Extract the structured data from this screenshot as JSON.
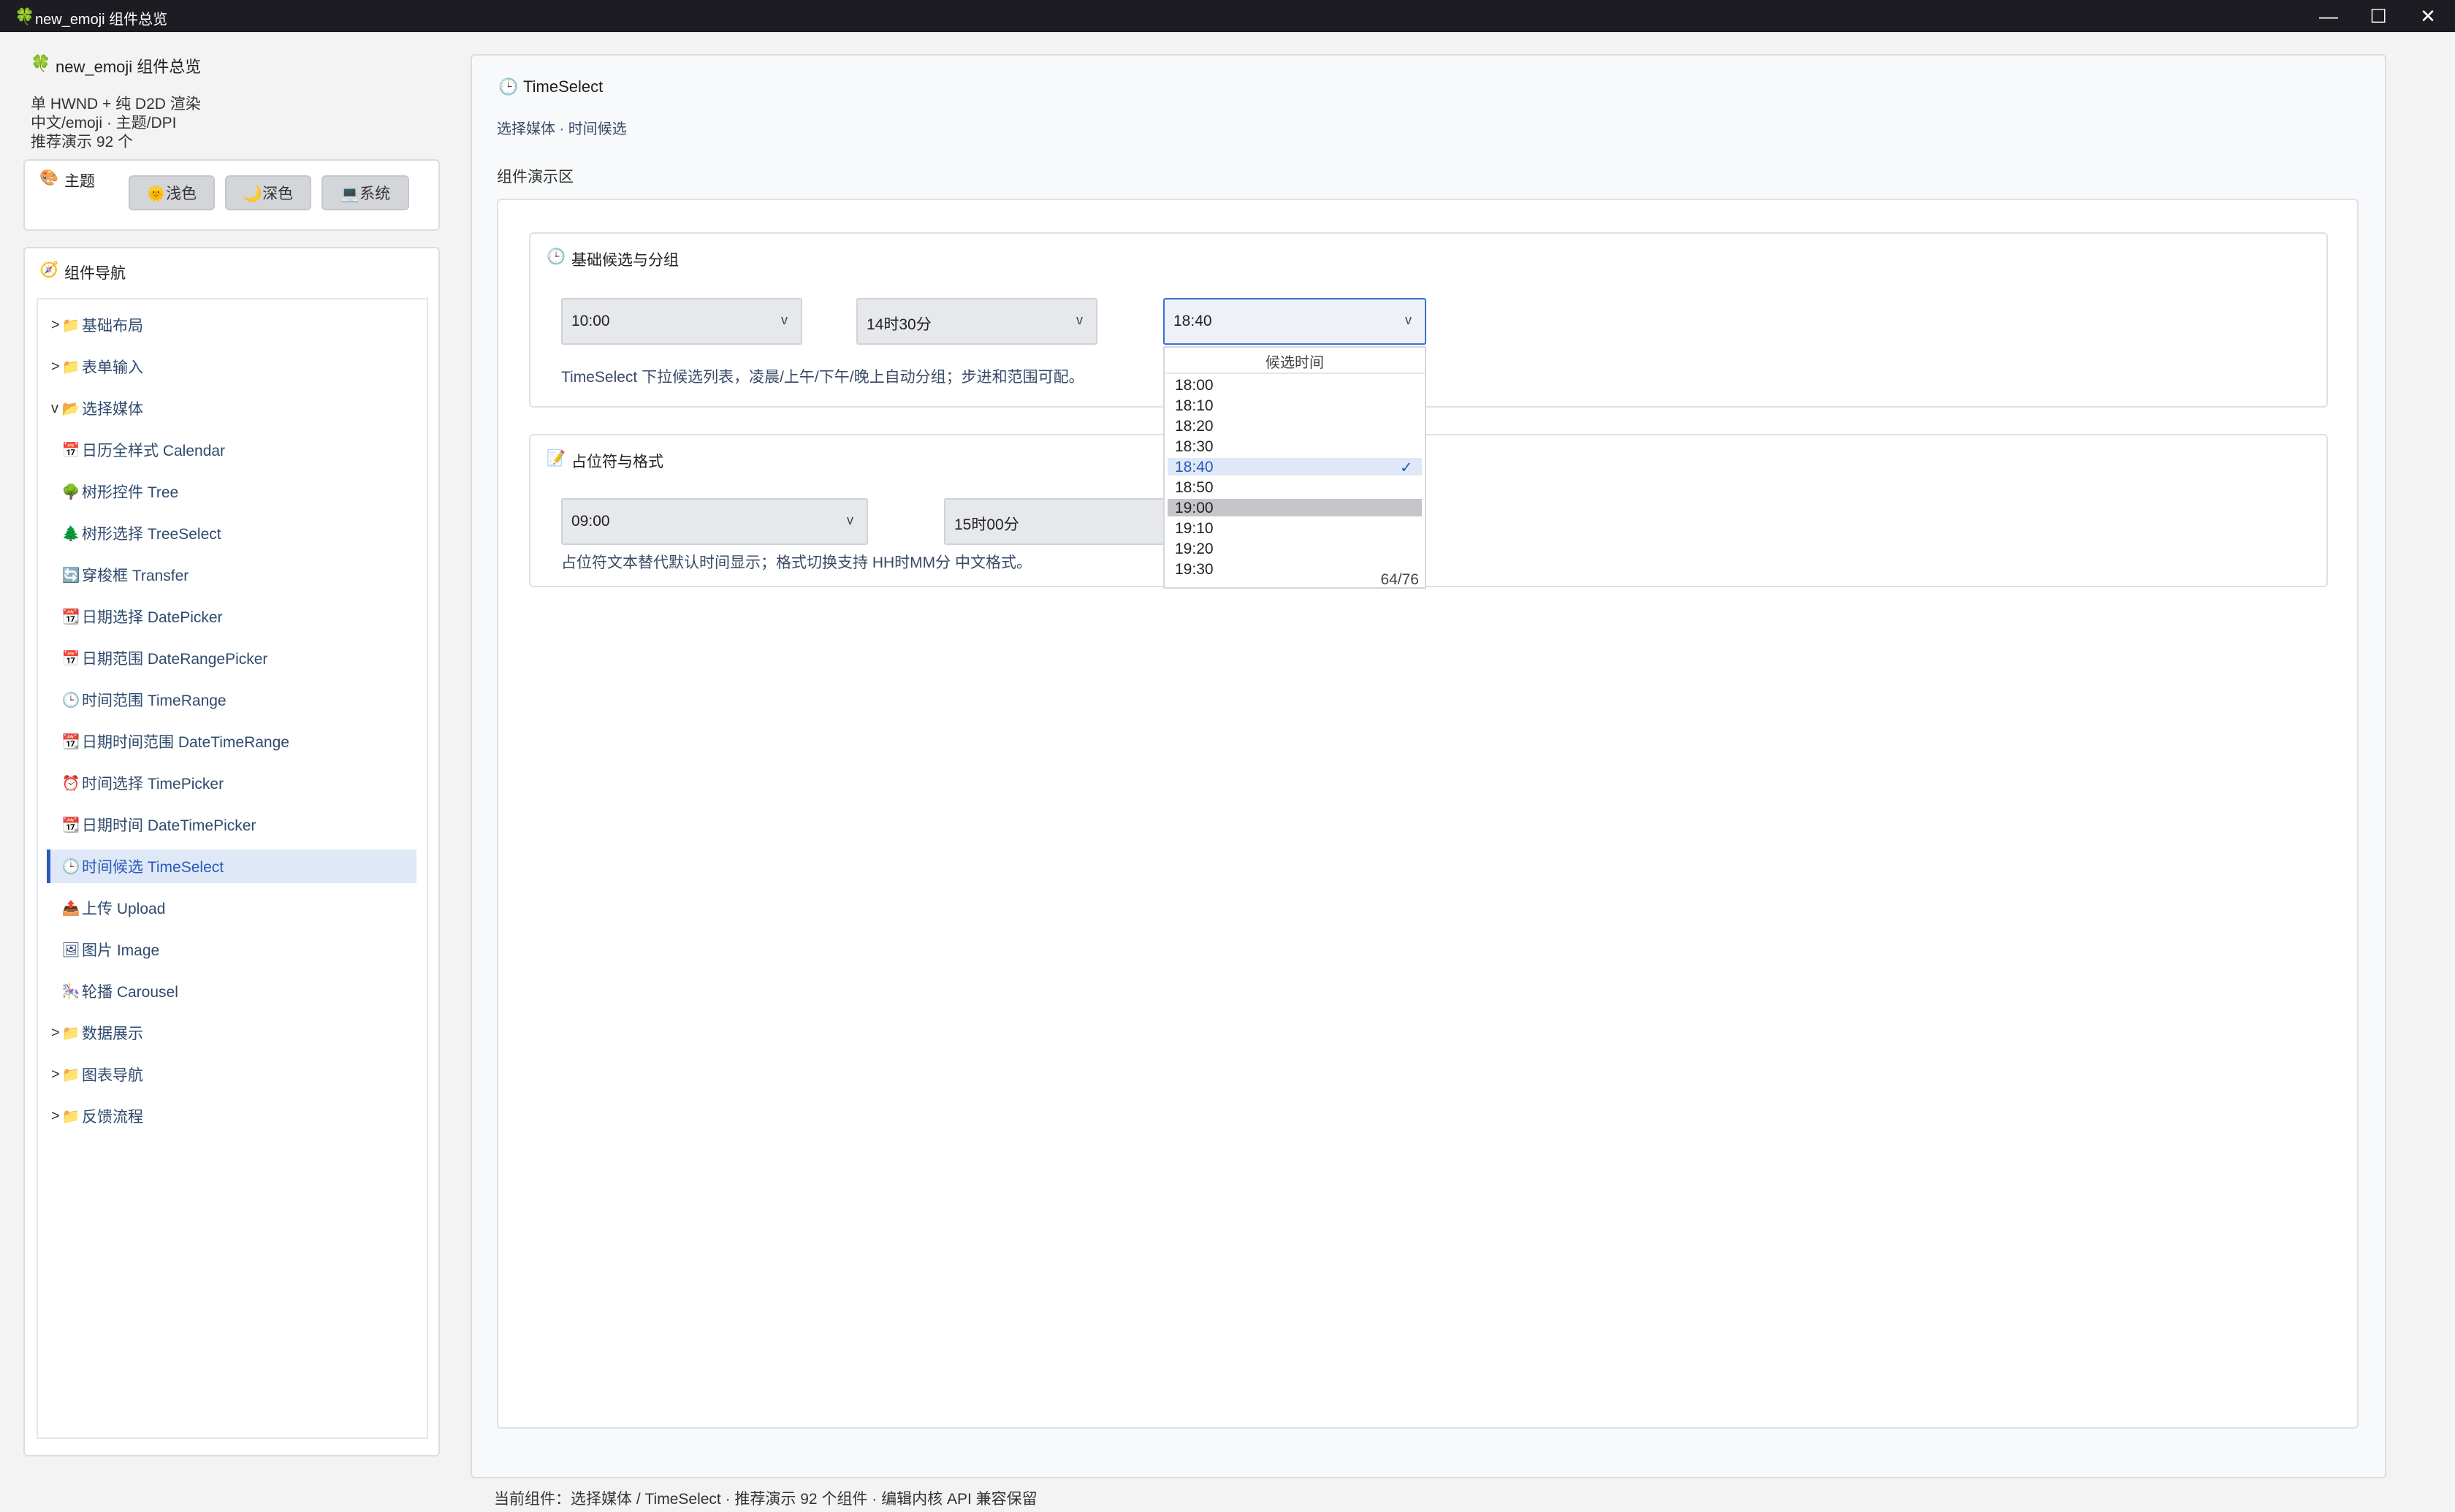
{
  "window": {
    "title": "new_emoji 组件总览",
    "minimize": "—",
    "maximize": "☐",
    "close": "✕"
  },
  "sidebar": {
    "app_title": "new_emoji 组件总览",
    "info_lines": [
      "单 HWND + 纯 D2D 渲染",
      "中文/emoji · 主题/DPI",
      "推荐演示 92 个"
    ],
    "theme": {
      "label": "主题",
      "buttons": [
        "🌞浅色",
        "🌙深色",
        "💻系统"
      ]
    },
    "nav": {
      "title": "组件导航",
      "items": [
        {
          "caret": ">",
          "icon": "📁",
          "label": "基础布局"
        },
        {
          "caret": ">",
          "icon": "📁",
          "label": "表单输入"
        },
        {
          "caret": "v",
          "icon": "📂",
          "label": "选择媒体"
        },
        {
          "icon": "📅",
          "label": "日历全样式 Calendar"
        },
        {
          "icon": "🌳",
          "label": "树形控件 Tree"
        },
        {
          "icon": "🌲",
          "label": "树形选择 TreeSelect"
        },
        {
          "icon": "🔄",
          "label": "穿梭框 Transfer"
        },
        {
          "icon": "📆",
          "label": "日期选择 DatePicker"
        },
        {
          "icon": "📅",
          "label": "日期范围 DateRangePicker"
        },
        {
          "icon": "🕒",
          "label": "时间范围 TimeRange"
        },
        {
          "icon": "📆",
          "label": "日期时间范围 DateTimeRange"
        },
        {
          "icon": "⏰",
          "label": "时间选择 TimePicker"
        },
        {
          "icon": "📆",
          "label": "日期时间 DateTimePicker"
        },
        {
          "icon": "🕒",
          "label": "时间候选 TimeSelect",
          "selected": true
        },
        {
          "icon": "📤",
          "label": "上传 Upload"
        },
        {
          "icon": "🖼",
          "label": "图片 Image"
        },
        {
          "icon": "🎠",
          "label": "轮播 Carousel"
        },
        {
          "caret": ">",
          "icon": "📁",
          "label": "数据展示"
        },
        {
          "caret": ">",
          "icon": "📁",
          "label": "图表导航"
        },
        {
          "caret": ">",
          "icon": "📁",
          "label": "反馈流程"
        }
      ]
    }
  },
  "main": {
    "title": "TimeSelect",
    "subtitle": "选择媒体 · 时间候选",
    "demo_area_label": "组件演示区",
    "section1": {
      "title": "基础候选与分组",
      "selects": [
        "10:00",
        "14时30分",
        "18:40"
      ],
      "description": "TimeSelect 下拉候选列表，凌晨/上午/下午/晚上自动分组；步进和范围可配。"
    },
    "section2": {
      "title": "占位符与格式",
      "selects": [
        "09:00",
        "15时00分"
      ],
      "description": "占位符文本替代默认时间显示；格式切换支持 HH时MM分 中文格式。"
    },
    "dropdown": {
      "header": "候选时间",
      "options": [
        "18:00",
        "18:10",
        "18:20",
        "18:30",
        "18:40",
        "18:50",
        "19:00",
        "19:10",
        "19:20",
        "19:30"
      ],
      "selected": "18:40",
      "hovered": "19:00",
      "check": "✓",
      "counter": "64/76"
    }
  },
  "footer": {
    "status": "当前组件：选择媒体 / TimeSelect · 推荐演示 92 个组件 · 编辑内核 API 兼容保留"
  },
  "colors": {
    "accent": "#2a5bb8",
    "selected_bg": "#dfe8f7",
    "hover_bg": "#c4c6ca",
    "titlebar": "#1c1c22"
  }
}
